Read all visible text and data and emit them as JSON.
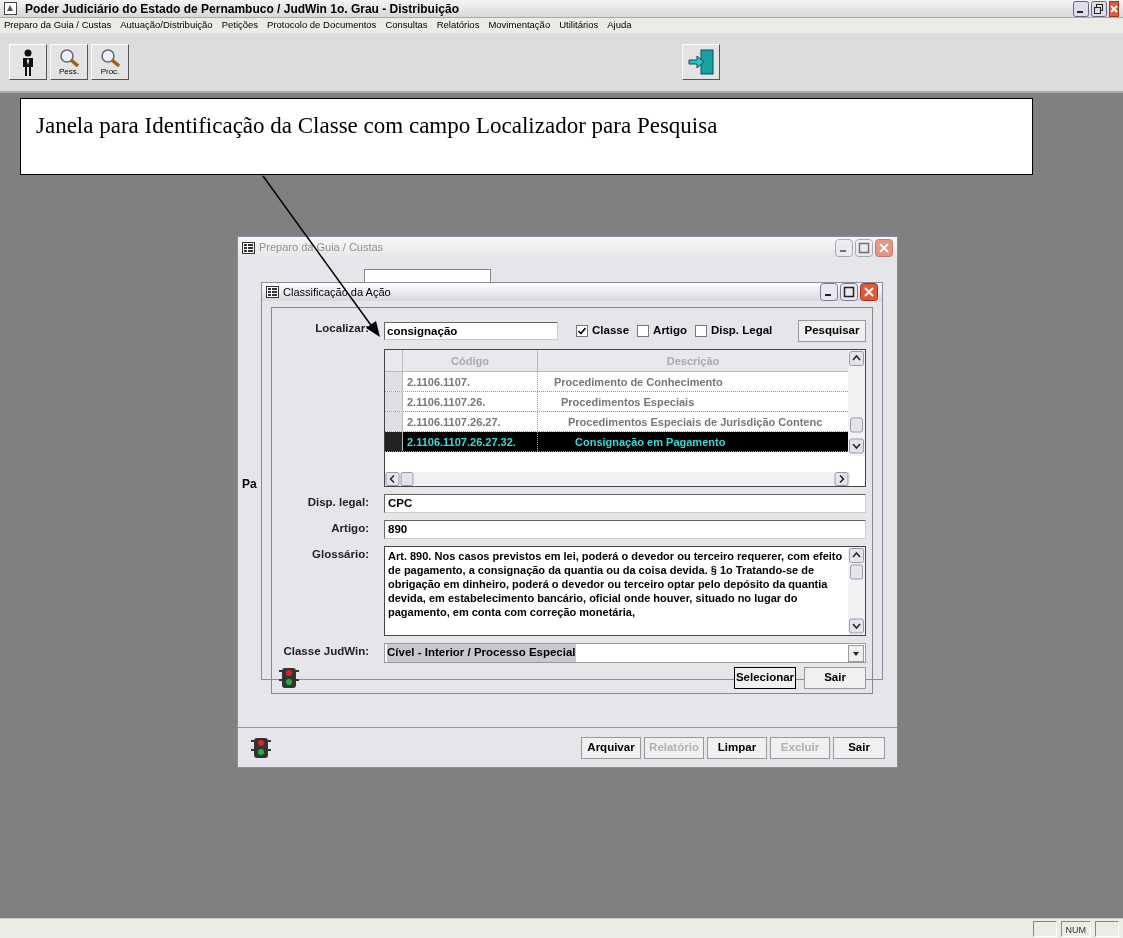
{
  "window": {
    "title": "Poder Judiciário do Estado de Pernambuco / JudWin 1o. Grau - Distribuição"
  },
  "menu": [
    "Preparo da Guia / Custas",
    "Autuação/Distribuição",
    "Petições",
    "Protocolo de Documentos",
    "Consultas",
    "Relatórios",
    "Movimentação",
    "Utilitários",
    "Ajuda"
  ],
  "toolbar": [
    {
      "kind": "person"
    },
    {
      "kind": "search",
      "label": "Pess."
    },
    {
      "kind": "search",
      "label": "Proc."
    },
    {
      "kind": "exit"
    }
  ],
  "callout": "Janela para Identificação da Classe com campo Localizador para Pesquisa",
  "outer_dialog": {
    "title": "Preparo da Guia / Custas",
    "active": false,
    "side_label": "Pa",
    "buttons": [
      {
        "label": "Arquivar",
        "disabled": false
      },
      {
        "label": "Relatório",
        "disabled": true
      },
      {
        "label": "Limpar",
        "disabled": false
      },
      {
        "label": "Excluir",
        "disabled": true
      },
      {
        "label": "Sair",
        "disabled": false
      }
    ]
  },
  "dialog": {
    "title": "Classificação da Ação",
    "active": true,
    "search": {
      "label": "Localizar:",
      "value": "consignação"
    },
    "filters": [
      {
        "label": "Classe",
        "checked": true
      },
      {
        "label": "Artigo",
        "checked": false
      },
      {
        "label": "Disp. Legal",
        "checked": false
      }
    ],
    "search_button": "Pesquisar",
    "table": {
      "columns": [
        "Código",
        "Descrição"
      ],
      "rows": [
        {
          "code": "2.1106.1107.",
          "description": "Procedimento de Conhecimento",
          "selected": false,
          "children": [
            {
              "code": "2.1106.1107.26.",
              "description": "Procedimentos Especiais",
              "selected": false,
              "children": [
                {
                  "code": "2.1106.1107.26.27.",
                  "description": "Procedimentos Especiais de Jurisdição Contenc",
                  "selected": false,
                  "children": [
                    {
                      "code": "2.1106.1107.26.27.32.",
                      "description": "Consignação em Pagamento",
                      "selected": true
                    }
                  ]
                }
              ]
            }
          ]
        }
      ]
    },
    "disp_legal": {
      "label": "Disp. legal:",
      "value": "CPC"
    },
    "artigo": {
      "label": "Artigo:",
      "value": "890"
    },
    "glossario": {
      "label": "Glossário:",
      "value": "Art. 890. Nos casos previstos em lei, poderá o devedor ou terceiro requerer, com efeito de pagamento, a consignação da quantia ou da coisa devida. § 1o Tratando-se de obrigação em dinheiro, poderá o devedor ou terceiro optar pelo depósito da quantia devida, em estabelecimento bancário, oficial onde houver, situado no lugar do pagamento, em conta com correção monetária,"
    },
    "classe": {
      "label": "Classe JudWin:",
      "value": "Cível - Interior / Processo Especial"
    },
    "buttons": [
      {
        "label": "Selecionar",
        "disabled": false,
        "default": true
      },
      {
        "label": "Sair",
        "disabled": false,
        "default": false
      }
    ]
  },
  "status_bar": {
    "num_lock": "NUM"
  }
}
